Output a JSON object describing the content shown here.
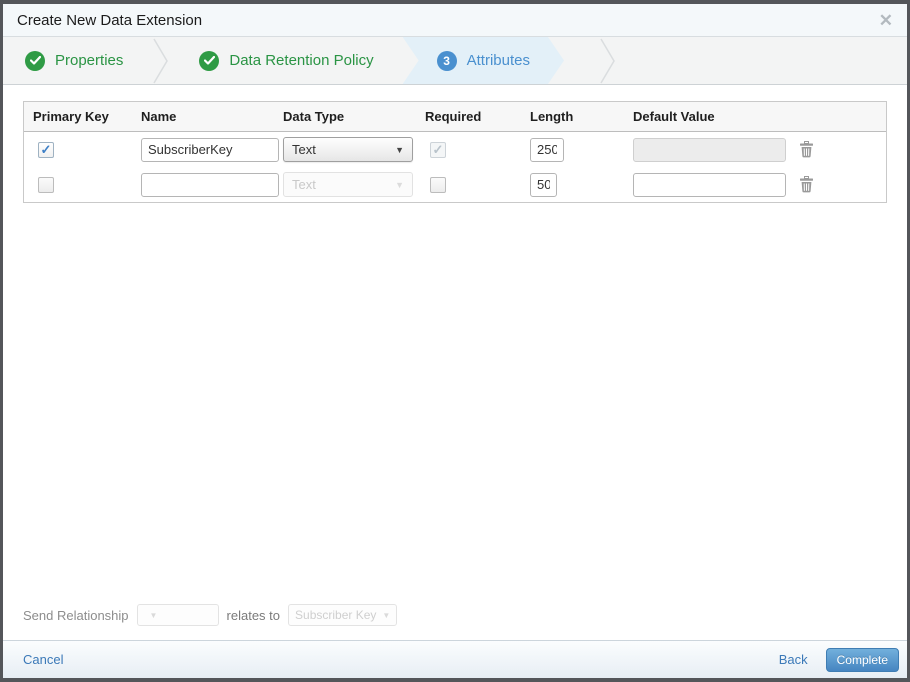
{
  "dialog": {
    "title": "Create New Data Extension",
    "close_label": "✕"
  },
  "stepper": {
    "steps": [
      {
        "label": "Properties",
        "status": "complete"
      },
      {
        "label": "Data Retention Policy",
        "status": "complete"
      },
      {
        "label": "Attributes",
        "status": "active",
        "number": "3"
      }
    ]
  },
  "table": {
    "headers": [
      "Primary Key",
      "Name",
      "Data Type",
      "Required",
      "Length",
      "Default Value"
    ],
    "rows": [
      {
        "primary_key_checked": true,
        "name": "SubscriberKey",
        "data_type": "Text",
        "data_type_disabled": false,
        "required_checked": true,
        "required_disabled": true,
        "length": "250",
        "default_value": "",
        "default_disabled": true
      },
      {
        "primary_key_checked": false,
        "name": "",
        "data_type": "Text",
        "data_type_disabled": true,
        "required_checked": false,
        "required_disabled": false,
        "length": "50",
        "default_value": "",
        "default_disabled": false
      }
    ]
  },
  "send_relationship": {
    "label": "Send Relationship",
    "selected_field": "",
    "relates_to_label": "relates to",
    "target_field": "Subscriber Key"
  },
  "footer": {
    "cancel_label": "Cancel",
    "back_label": "Back",
    "complete_label": "Complete"
  },
  "colors": {
    "step_complete_green": "#2f9b45",
    "step_active_blue": "#4a90cf",
    "link_blue": "#3b79b8",
    "primary_button_blue": "#4685c1"
  }
}
